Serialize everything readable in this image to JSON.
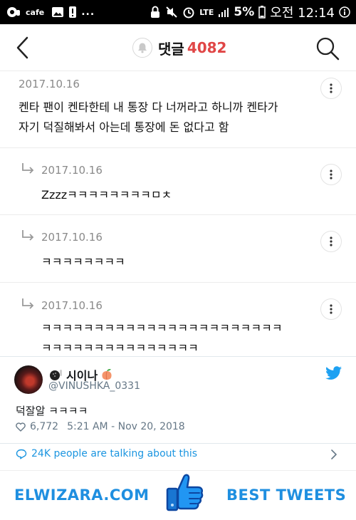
{
  "statusbar": {
    "cafe_label": "cafe",
    "dots": "...",
    "network": "LTE",
    "battery": "5%",
    "time": "오전 12:14"
  },
  "header": {
    "label": "댓글",
    "count": "4082"
  },
  "comments": [
    {
      "date": "2017.10.16",
      "lines": [
        "켄타 팬이 켄타한테 내 통장 다 너꺼라고 하니까 켄타가",
        "자기 덕질해봐서 아는데 통장에 돈 없다고 함"
      ]
    },
    {
      "date": "2017.10.16",
      "lines": [
        "Zzzzㅋㅋㅋㅋㅋㅋㅋㅋㅁㅊ"
      ]
    },
    {
      "date": "2017.10.16",
      "lines": [
        "ㅋㅋㅋㅋㅋㅋㅋㅋ"
      ]
    },
    {
      "date": "2017.10.16",
      "lines": [
        "ㅋㅋㅋㅋㅋㅋㅋㅋㅋㅋㅋㅋㅋㅋㅋㅋㅋㅋㅋㅋㅋㅋㅋ",
        "ㅋㅋㅋㅋㅋㅋㅋㅋㅋㅋㅋㅋㅋㅋㅋ"
      ]
    }
  ],
  "tweet": {
    "name": "시이나",
    "handle": "@VINUSHKA_0331",
    "text": "덕잘알 ㅋㅋㅋㅋ",
    "likes": "6,772",
    "timestamp": "5:21 AM - Nov 20, 2018",
    "talking": "24K people are talking about this"
  },
  "banner": {
    "left": "ELWIZARA.COM",
    "right": "BEST TWEETS"
  },
  "colors": {
    "count_red": "#e04646",
    "twitter_blue": "#1b95e0",
    "banner_blue": "#1f8fe0"
  }
}
